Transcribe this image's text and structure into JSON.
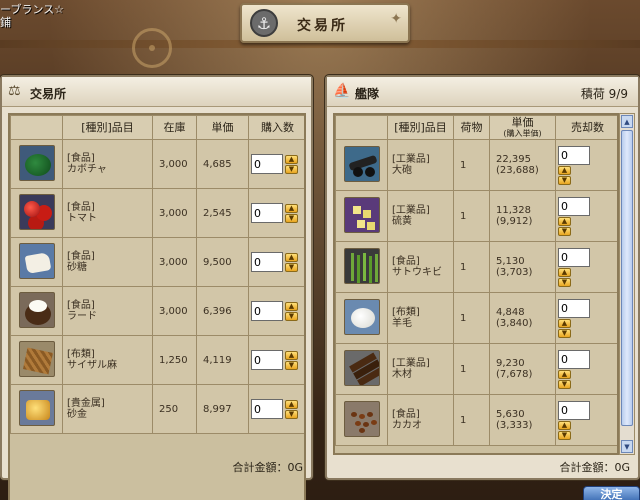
{
  "header": {
    "top_left_line1": "ーブランス☆",
    "top_left_line2": "鋪",
    "banner_title": "交易所",
    "banner_emblem_icon": "anchor-icon",
    "banner_compass_icon": "compass-icon"
  },
  "left_panel": {
    "title": "交易所",
    "title_icon": "scales-icon",
    "columns": [
      "[種別]品目",
      "在庫",
      "単価",
      "購入数"
    ],
    "items": [
      {
        "category": "[食品]",
        "name": "カボチャ",
        "stock": "3,000",
        "price": "4,685",
        "qty": "0",
        "icon": "pumpkin-icon"
      },
      {
        "category": "[食品]",
        "name": "トマト",
        "stock": "3,000",
        "price": "2,545",
        "qty": "0",
        "icon": "tomato-icon"
      },
      {
        "category": "[食品]",
        "name": "砂糖",
        "stock": "3,000",
        "price": "9,500",
        "qty": "0",
        "icon": "sugar-icon"
      },
      {
        "category": "[食品]",
        "name": "ラード",
        "stock": "3,000",
        "price": "6,396",
        "qty": "0",
        "icon": "lard-icon"
      },
      {
        "category": "[布類]",
        "name": "サイザル麻",
        "stock": "1,250",
        "price": "4,119",
        "qty": "0",
        "icon": "sisal-icon"
      },
      {
        "category": "[貴金属]",
        "name": "砂金",
        "stock": "250",
        "price": "8,997",
        "qty": "0",
        "icon": "gold-dust-icon"
      }
    ],
    "total": "合計金額：0G"
  },
  "right_panel": {
    "title": "艦隊",
    "title_icon": "ship-icon",
    "cargo": "積荷 9/9",
    "columns": {
      "item": "[種別]品目",
      "hold": "荷物",
      "price": "単価",
      "price_sub": "(購入単価)",
      "sell": "売却数"
    },
    "items": [
      {
        "category": "[工業品]",
        "name": "大砲",
        "hold": "1",
        "price": "22,395",
        "purchase": "(23,688)",
        "qty": "0",
        "icon": "cannon-icon"
      },
      {
        "category": "[工業品]",
        "name": "硫黄",
        "hold": "1",
        "price": "11,328",
        "purchase": "(9,912)",
        "qty": "0",
        "icon": "sulfur-icon"
      },
      {
        "category": "[食品]",
        "name": "サトウキビ",
        "hold": "1",
        "price": "5,130",
        "purchase": "(3,703)",
        "qty": "0",
        "icon": "sugarcane-icon"
      },
      {
        "category": "[布類]",
        "name": "羊毛",
        "hold": "1",
        "price": "4,848",
        "purchase": "(3,840)",
        "qty": "0",
        "icon": "wool-icon"
      },
      {
        "category": "[工業品]",
        "name": "木材",
        "hold": "1",
        "price": "9,230",
        "purchase": "(7,678)",
        "qty": "0",
        "icon": "lumber-icon"
      },
      {
        "category": "[食品]",
        "name": "カカオ",
        "hold": "1",
        "price": "5,630",
        "purchase": "(3,333)",
        "qty": "0",
        "icon": "cacao-icon"
      }
    ],
    "total": "合計金額：0G"
  },
  "footer": {
    "decide_label": "決定"
  }
}
